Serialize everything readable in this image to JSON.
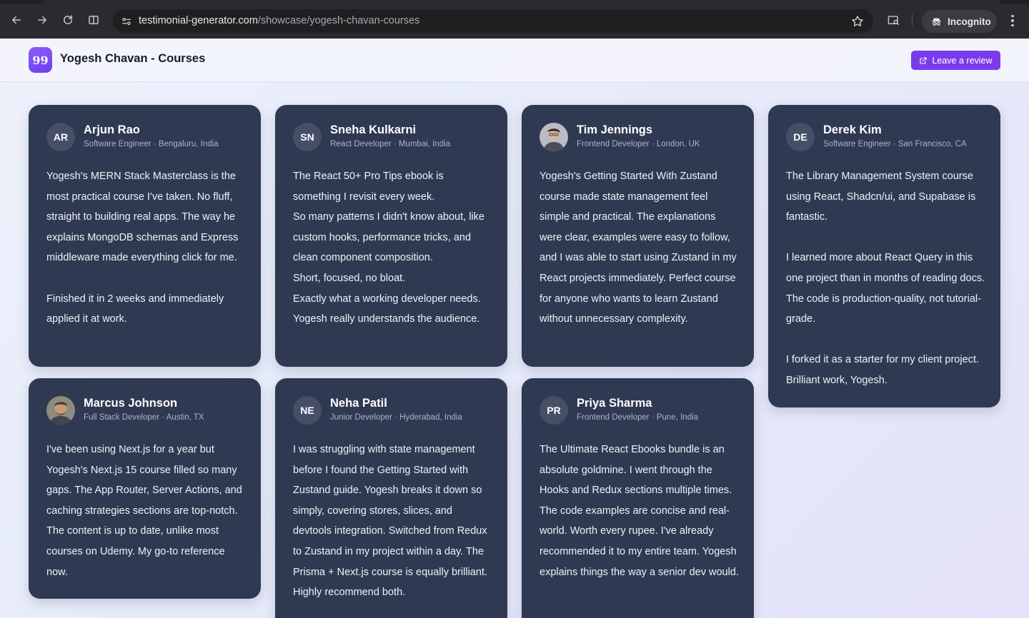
{
  "browser": {
    "url_host": "testimonial-generator.com",
    "url_path": "/showcase/yogesh-chavan-courses",
    "incognito_label": "Incognito",
    "icons": [
      "back-arrow-icon",
      "forward-arrow-icon",
      "reload-icon",
      "split-view-icon",
      "site-info-icon",
      "star-icon",
      "search-tab-icon",
      "incognito-icon",
      "more-vert-icon"
    ]
  },
  "header": {
    "logo_glyph": "99",
    "title": "Yogesh Chavan - Courses",
    "cta_label": "Leave a review",
    "accent_color": "#7c3aed"
  },
  "testimonials": [
    {
      "initials": "AR",
      "name": "Arjun Rao",
      "meta": "Software Engineer · Bengaluru, India",
      "text": "Yogesh's MERN Stack Masterclass is the most practical course I've taken. No fluff, straight to building real apps. The way he explains MongoDB schemas and Express middleware made everything click for me.\n\nFinished it in 2 weeks and immediately applied it at work."
    },
    {
      "initials": "SN",
      "name": "Sneha Kulkarni",
      "meta": "React Developer · Mumbai, India",
      "text": "The React 50+ Pro Tips ebook is something I revisit every week.\nSo many patterns I didn't know about, like custom hooks, performance tricks, and clean component composition.\nShort, focused, no bloat.\nExactly what a working developer needs. Yogesh really understands the audience."
    },
    {
      "initials": "",
      "name": "Tim Jennings",
      "meta": "Frontend Developer · London, UK",
      "text": "Yogesh's Getting Started With Zustand course made state management feel simple and practical. The explanations were clear, examples were easy to follow, and I was able to start using Zustand in my React projects immediately. Perfect course for anyone who wants to learn Zustand without unnecessary complexity."
    },
    {
      "initials": "DE",
      "name": "Derek Kim",
      "meta": "Software Engineer · San Francisco, CA",
      "text": "The Library Management System course using React, Shadcn/ui, and Supabase is fantastic.\n\nI learned more about React Query in this one project than in months of reading docs. The code is production-quality, not tutorial-grade.\n\nI forked it as a starter for my client project. Brilliant work, Yogesh."
    },
    {
      "initials": "",
      "name": "Marcus Johnson",
      "meta": "Full Stack Developer · Austin, TX",
      "text": "I've been using Next.js for a year but Yogesh's Next.js 15 course filled so many gaps. The App Router, Server Actions, and caching strategies sections are top-notch. The content is up to date, unlike most courses on Udemy. My go-to reference now."
    },
    {
      "initials": "NE",
      "name": "Neha Patil",
      "meta": "Junior Developer · Hyderabad, India",
      "text": "I was struggling with state management before I found the Getting Started with Zustand guide. Yogesh breaks it down so simply, covering stores, slices, and devtools integration. Switched from Redux to Zustand in my project within a day. The Prisma + Next.js course is equally brilliant. Highly recommend both."
    },
    {
      "initials": "PR",
      "name": "Priya Sharma",
      "meta": "Frontend Developer · Pune, India",
      "text": "The Ultimate React Ebooks bundle is an absolute goldmine. I went through the Hooks and Redux sections multiple times. The code examples are concise and real-world. Worth every rupee. I've already recommended it to my entire team. Yogesh explains things the way a senior dev would."
    }
  ]
}
